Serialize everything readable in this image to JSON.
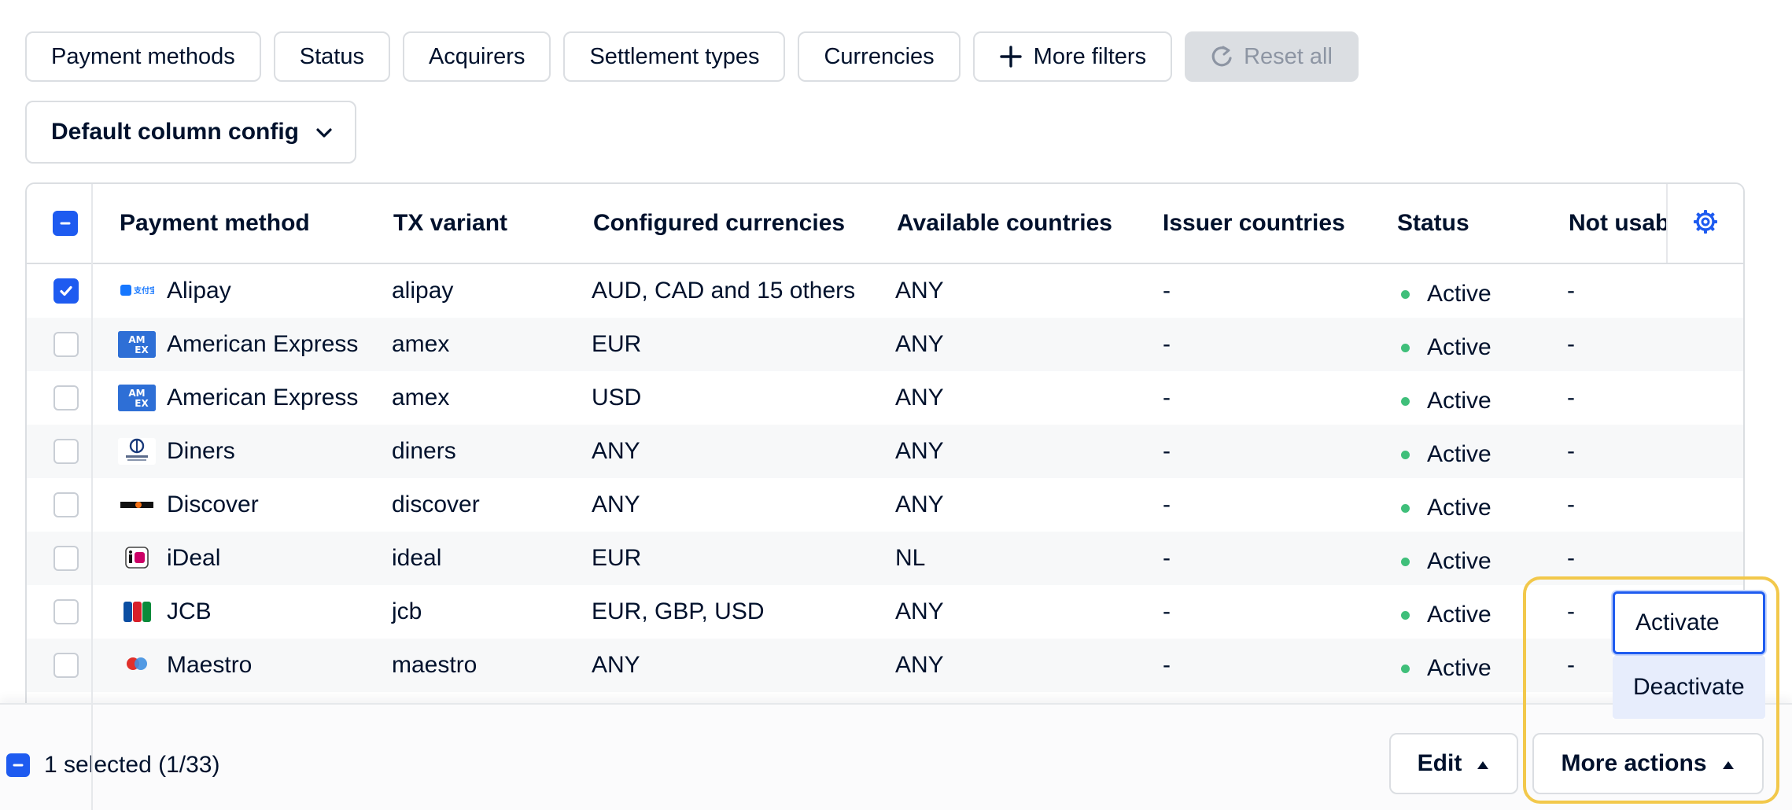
{
  "filters": {
    "payment_methods": "Payment methods",
    "status": "Status",
    "acquirers": "Acquirers",
    "settlement_types": "Settlement types",
    "currencies": "Currencies",
    "more_filters": "More filters",
    "reset_all": "Reset all"
  },
  "column_config": {
    "label": "Default column config"
  },
  "table": {
    "headers": {
      "payment_method": "Payment method",
      "tx_variant": "TX variant",
      "configured_currencies": "Configured currencies",
      "available_countries": "Available countries",
      "issuer_countries": "Issuer countries",
      "status": "Status",
      "not_usable": "Not usab"
    },
    "rows": [
      {
        "name": "Alipay",
        "variant": "alipay",
        "currencies": "AUD, CAD and 15 others",
        "countries": "ANY",
        "issuer": "-",
        "status": "Active",
        "not_usable": "-",
        "checked": true,
        "logo_icon": "alipay-logo"
      },
      {
        "name": "American Express",
        "variant": "amex",
        "currencies": "EUR",
        "countries": "ANY",
        "issuer": "-",
        "status": "Active",
        "not_usable": "-",
        "checked": false,
        "logo_icon": "amex-logo"
      },
      {
        "name": "American Express",
        "variant": "amex",
        "currencies": "USD",
        "countries": "ANY",
        "issuer": "-",
        "status": "Active",
        "not_usable": "-",
        "checked": false,
        "logo_icon": "amex-logo"
      },
      {
        "name": "Diners",
        "variant": "diners",
        "currencies": "ANY",
        "countries": "ANY",
        "issuer": "-",
        "status": "Active",
        "not_usable": "-",
        "checked": false,
        "logo_icon": "diners-logo"
      },
      {
        "name": "Discover",
        "variant": "discover",
        "currencies": "ANY",
        "countries": "ANY",
        "issuer": "-",
        "status": "Active",
        "not_usable": "-",
        "checked": false,
        "logo_icon": "discover-logo"
      },
      {
        "name": "iDeal",
        "variant": "ideal",
        "currencies": "EUR",
        "countries": "NL",
        "issuer": "-",
        "status": "Active",
        "not_usable": "-",
        "checked": false,
        "logo_icon": "ideal-logo"
      },
      {
        "name": "JCB",
        "variant": "jcb",
        "currencies": "EUR, GBP, USD",
        "countries": "ANY",
        "issuer": "-",
        "status": "Active",
        "not_usable": "-",
        "checked": false,
        "logo_icon": "jcb-logo"
      },
      {
        "name": "Maestro",
        "variant": "maestro",
        "currencies": "ANY",
        "countries": "ANY",
        "issuer": "-",
        "status": "Active",
        "not_usable": "-",
        "checked": false,
        "logo_icon": "maestro-logo"
      }
    ]
  },
  "footer": {
    "selected": "1 selected (1/33)",
    "edit": "Edit",
    "more_actions": "More actions"
  },
  "menu": {
    "activate": "Activate",
    "deactivate": "Deactivate"
  },
  "colors": {
    "accent": "#1e5bf0",
    "status_active": "#3fbf7a",
    "highlight": "#f2c84b"
  }
}
